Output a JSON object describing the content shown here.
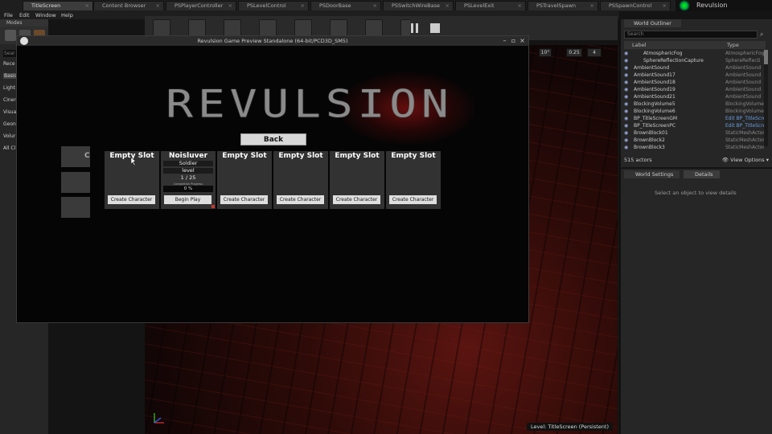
{
  "tabs": [
    {
      "label": "TitleScreen",
      "active": true
    },
    {
      "label": "Content Browser"
    },
    {
      "label": "PSPlayerController"
    },
    {
      "label": "PSLevelControl"
    },
    {
      "label": "PSDoorBase"
    },
    {
      "label": "PSSwitchWireBase"
    },
    {
      "label": "PSLevelExit"
    },
    {
      "label": "PSTravelSpawn"
    },
    {
      "label": "PSSpawnControl"
    }
  ],
  "brand": {
    "name": "Revulsion"
  },
  "menu": [
    "File",
    "Edit",
    "Window",
    "Help"
  ],
  "modes": {
    "title": "Modes",
    "search_placeholder": "Sear",
    "items": [
      "Rece",
      "Basic",
      "Light",
      "Ciner",
      "Visua",
      "Geon",
      "Volur",
      "All Cl"
    ]
  },
  "viewport": {
    "buttons": [
      "10°",
      "0.25",
      "4"
    ],
    "level": "Level:  TitleScreen (Persistent)"
  },
  "outliner": {
    "title": "World Outliner",
    "search_placeholder": "Search",
    "col_label": "Label",
    "col_type": "Type",
    "rows": [
      {
        "name": "AtmosphericFog",
        "type": "AtmosphericFog",
        "indent": 1
      },
      {
        "name": "SphereReflectionCapture",
        "type": "SphereReflecti",
        "indent": 1
      },
      {
        "name": "AmbientSound",
        "type": "AmbientSound",
        "indent": 0
      },
      {
        "name": "AmbientSound17",
        "type": "AmbientSound",
        "indent": 0
      },
      {
        "name": "AmbientSound18",
        "type": "AmbientSound",
        "indent": 0
      },
      {
        "name": "AmbientSound19",
        "type": "AmbientSound",
        "indent": 0
      },
      {
        "name": "AmbientSound21",
        "type": "AmbientSound",
        "indent": 0
      },
      {
        "name": "BlockingVolume5",
        "type": "BlockingVolume",
        "indent": 0
      },
      {
        "name": "BlockingVolume6",
        "type": "BlockingVolume",
        "indent": 0
      },
      {
        "name": "BP_TitleScreenGM",
        "type": "Edit BP_TitleScre",
        "indent": 0,
        "link": true
      },
      {
        "name": "BP_TitleScreenPC",
        "type": "Edit BP_TitleScre",
        "indent": 0,
        "link": true
      },
      {
        "name": "BrownBlock01",
        "type": "StaticMeshActor",
        "indent": 0
      },
      {
        "name": "BrownBlock2",
        "type": "StaticMeshActor",
        "indent": 0
      },
      {
        "name": "BrownBlock3",
        "type": "StaticMeshActor",
        "indent": 0
      }
    ],
    "count": "515 actors",
    "view_options": "View Options"
  },
  "details": {
    "tab_world": "World Settings",
    "tab_details": "Details",
    "empty": "Select an object to view details"
  },
  "game": {
    "window_title": "Revulsion Game Preview Standalone (64-bit/PCD3D_SM5)",
    "logo": "REVULSION",
    "back": "Back",
    "ghost_letter": "C",
    "slots": [
      {
        "title": "Empty Slot",
        "button": "Create Character"
      },
      {
        "title": "Noisluver",
        "class": "Soldier",
        "level_label": "level",
        "level": "1 / 25",
        "progress_label": "Completion Progress",
        "progress": "0 %",
        "button": "Begin Play"
      },
      {
        "title": "Empty Slot",
        "button": "Create Character"
      },
      {
        "title": "Empty Slot",
        "button": "Create Character"
      },
      {
        "title": "Empty Slot",
        "button": "Create Character"
      },
      {
        "title": "Empty Slot",
        "button": "Create Character"
      }
    ]
  },
  "colors": {
    "accent_link": "#6a9de0",
    "brand_green": "#00cc44",
    "glow_red": "#b41414"
  }
}
